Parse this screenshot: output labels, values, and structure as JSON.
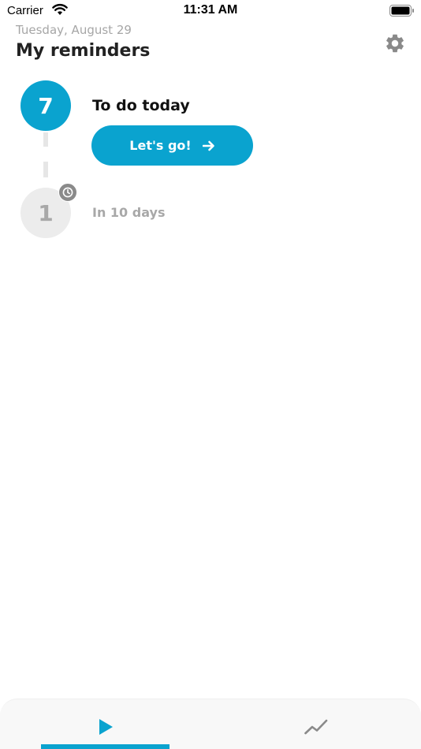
{
  "status_bar": {
    "carrier": "Carrier",
    "time": "11:31 AM",
    "icons": [
      "wifi-icon",
      "battery-icon"
    ]
  },
  "header": {
    "date": "Tuesday, August 29",
    "title": "My reminders",
    "settings_icon": "gear-icon"
  },
  "today": {
    "count": "7",
    "title": "To do today",
    "button_label": "Let's go!",
    "button_icon": "arrow-right-icon"
  },
  "upcoming": {
    "count": "1",
    "badge_icon": "clock-icon",
    "title": "In 10 days"
  },
  "tab_bar": {
    "tabs": [
      {
        "icon": "play-icon",
        "selected": true
      },
      {
        "icon": "chart-line-icon",
        "selected": false
      }
    ]
  },
  "colors": {
    "accent": "#0aa3cf",
    "inactive_circle": "#ececec",
    "inactive_text": "#a8a8a8",
    "date_text": "#a6a6a6",
    "icon_gray": "#8a8a8a"
  }
}
